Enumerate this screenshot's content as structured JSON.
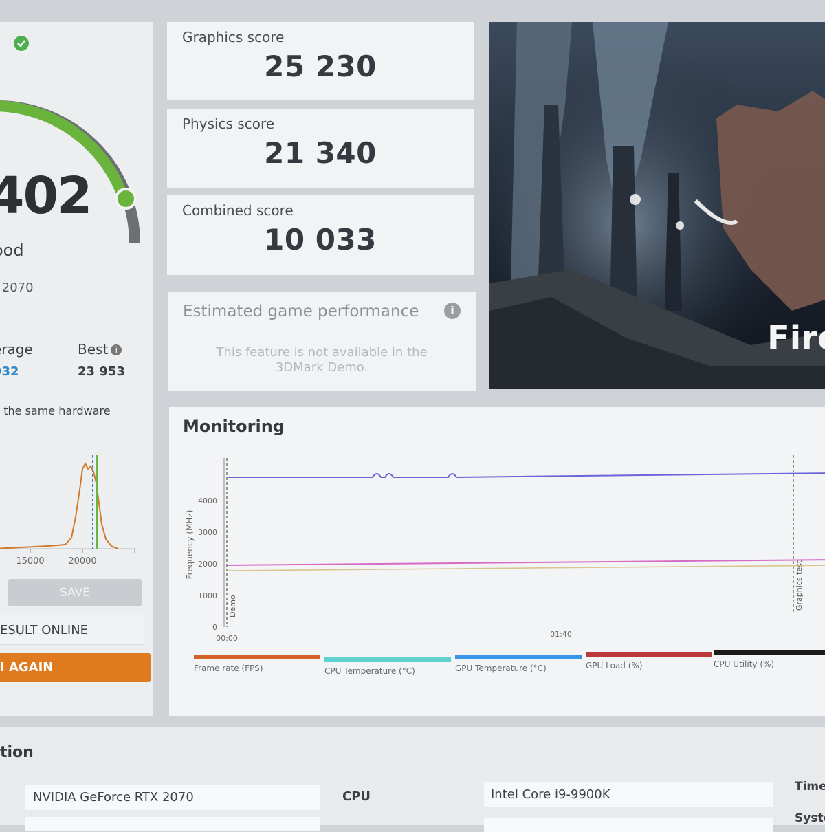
{
  "colors": {
    "accent_orange": "#e07a1f",
    "gauge_green": "#6ab43e",
    "average_blue": "#2f88c8"
  },
  "overall": {
    "score_visible": "402",
    "rating_visible": "ood",
    "gpu_visible": "( 2070",
    "average_label_visible": "erage",
    "average_value_visible": "932",
    "best_label": "Best",
    "best_value": "23 953",
    "same_hardware_visible": "n the same hardware",
    "dist_ticks": [
      "15000",
      "20000"
    ],
    "save_label": "SAVE",
    "result_online_visible": "ESULT ONLINE",
    "run_again_visible": "I AGAIN"
  },
  "scores": {
    "graphics": {
      "label": "Graphics score",
      "value": "25 230"
    },
    "physics": {
      "label": "Physics score",
      "value": "21 340"
    },
    "combined": {
      "label": "Combined score",
      "value": "10 033"
    }
  },
  "estimated": {
    "title": "Estimated game performance",
    "message": "This feature is not available in the 3DMark Demo."
  },
  "game_image": {
    "title_visible": "Fire"
  },
  "monitoring": {
    "title": "Monitoring",
    "ylabel": "Frequency (MHz)",
    "y_ticks": [
      "4000",
      "3000",
      "2000",
      "1000",
      "0"
    ],
    "x_ticks": [
      "00:00",
      "01:40"
    ],
    "markers": [
      "Demo",
      "Graphics test"
    ],
    "legend": [
      {
        "label": "Frame rate (FPS)",
        "color": "#d4632a"
      },
      {
        "label": "CPU Temperature (°C)",
        "color": "#5fd2d0"
      },
      {
        "label": "GPU Temperature (°C)",
        "color": "#3b95e6"
      },
      {
        "label": "GPU Load (%)",
        "color": "#b83a3a"
      },
      {
        "label": "CPU Utility (%)",
        "color": "#1b1b1b"
      }
    ]
  },
  "sysinfo": {
    "title_visible": "tion",
    "gpu": "NVIDIA GeForce RTX 2070",
    "cpu_label": "CPU",
    "cpu": "Intel Core i9-9900K",
    "time_label": "Time",
    "system_label": "Syste"
  }
}
